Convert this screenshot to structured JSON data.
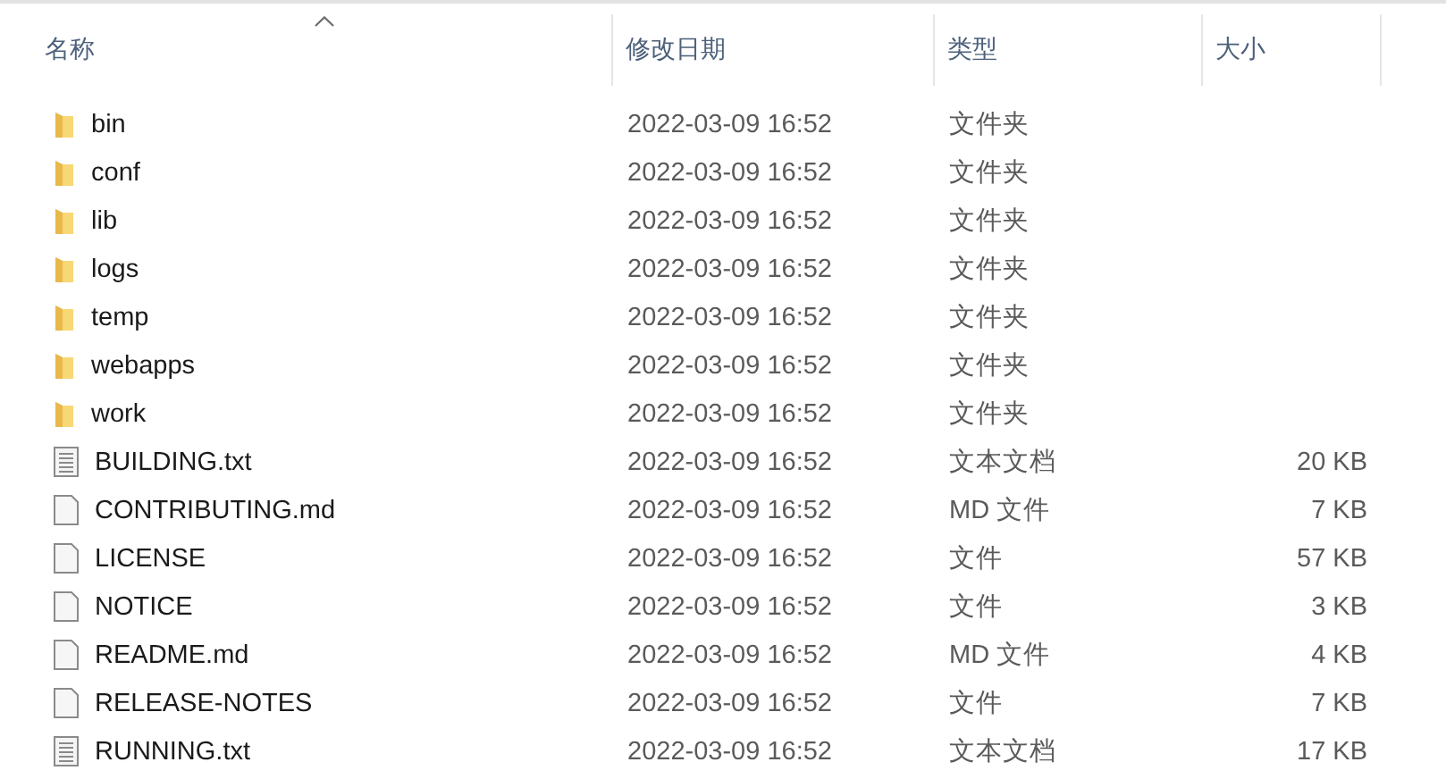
{
  "columns": [
    {
      "label": "名称",
      "sorted": true
    },
    {
      "label": "修改日期",
      "sorted": false
    },
    {
      "label": "类型",
      "sorted": false
    },
    {
      "label": "大小",
      "sorted": false
    }
  ],
  "rows": [
    {
      "kind": "folder",
      "name": "bin",
      "modified": "2022-03-09 16:52",
      "type": "文件夹"
    },
    {
      "kind": "folder",
      "name": "conf",
      "modified": "2022-03-09 16:52",
      "type": "文件夹"
    },
    {
      "kind": "folder",
      "name": "lib",
      "modified": "2022-03-09 16:52",
      "type": "文件夹"
    },
    {
      "kind": "folder",
      "name": "logs",
      "modified": "2022-03-09 16:52",
      "type": "文件夹"
    },
    {
      "kind": "folder",
      "name": "temp",
      "modified": "2022-03-09 16:52",
      "type": "文件夹"
    },
    {
      "kind": "folder",
      "name": "webapps",
      "modified": "2022-03-09 16:52",
      "type": "文件夹"
    },
    {
      "kind": "folder",
      "name": "work",
      "modified": "2022-03-09 16:52",
      "type": "文件夹"
    },
    {
      "kind": "text",
      "name": "BUILDING.txt",
      "modified": "2022-03-09 16:52",
      "type": "文本文档",
      "size": "20 KB"
    },
    {
      "kind": "file",
      "name": "CONTRIBUTING.md",
      "modified": "2022-03-09 16:52",
      "type": "MD 文件",
      "size": "7 KB"
    },
    {
      "kind": "file",
      "name": "LICENSE",
      "modified": "2022-03-09 16:52",
      "type": "文件",
      "size": "57 KB"
    },
    {
      "kind": "file",
      "name": "NOTICE",
      "modified": "2022-03-09 16:52",
      "type": "文件",
      "size": "3 KB"
    },
    {
      "kind": "file",
      "name": "README.md",
      "modified": "2022-03-09 16:52",
      "type": "MD 文件",
      "size": "4 KB"
    },
    {
      "kind": "file",
      "name": "RELEASE-NOTES",
      "modified": "2022-03-09 16:52",
      "type": "文件",
      "size": "7 KB"
    },
    {
      "kind": "text",
      "name": "RUNNING.txt",
      "modified": "2022-03-09 16:52",
      "type": "文本文档",
      "size": "17 KB"
    }
  ]
}
